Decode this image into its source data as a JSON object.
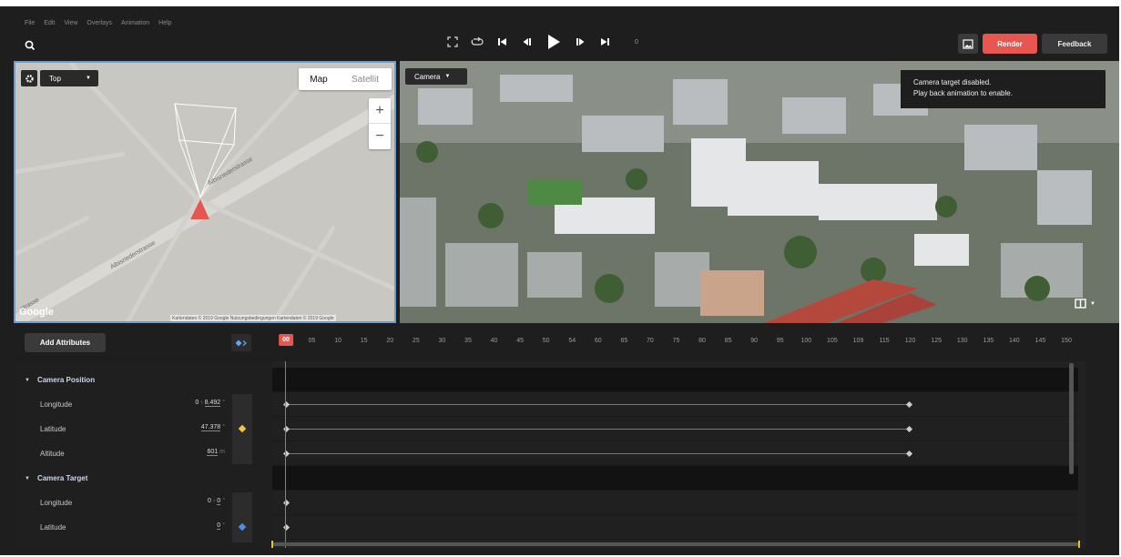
{
  "menu": [
    "File",
    "Edit",
    "View",
    "Overlays",
    "Animation",
    "Help"
  ],
  "icons": {
    "search": "search-icon",
    "fullscreen": "fullscreen-icon",
    "loop": "loop-icon",
    "skip_start": "skip-start-icon",
    "step_back": "step-back-icon",
    "play": "play-icon",
    "step_forward": "step-forward-icon",
    "skip_end": "skip-end-icon",
    "image": "image-icon",
    "settings": "gear-icon",
    "layout": "split-layout-icon"
  },
  "transport": {
    "frame": "0"
  },
  "toolbar": {
    "render_label": "Render",
    "feedback_label": "Feedback"
  },
  "map": {
    "view_label": "Top",
    "tab_map": "Map",
    "tab_satellite": "Satellit",
    "zoom_in": "+",
    "zoom_out": "−",
    "logo": "Google",
    "attribution": "Kartendaten © 2019 Google   Nutzungsbedingungen   Kartendaten © 2019 Google",
    "streets": [
      "Albisriederstrasse",
      "Albisriederstrasse",
      "strasse"
    ]
  },
  "camera_view": {
    "selector_label": "Camera",
    "notice_line1": "Camera target disabled.",
    "notice_line2": "Play back animation to enable."
  },
  "timeline": {
    "add_attributes_label": "Add Attributes",
    "ticks": [
      "00",
      "05",
      "10",
      "15",
      "20",
      "25",
      "30",
      "35",
      "40",
      "45",
      "50",
      "54",
      "60",
      "65",
      "70",
      "75",
      "80",
      "85",
      "90",
      "95",
      "100",
      "105",
      "109",
      "115",
      "120",
      "125",
      "130",
      "135",
      "140",
      "145",
      "150"
    ],
    "current_frame": "00",
    "groups": [
      {
        "name": "Camera Position",
        "rows": [
          {
            "name": "Longitude",
            "v1": "0",
            "v2": "8.492",
            "unit": "°"
          },
          {
            "name": "Latitude",
            "v1": "",
            "v2": "47.378",
            "unit": "°"
          },
          {
            "name": "Altitude",
            "v1": "",
            "v2": "601",
            "unit": "m"
          }
        ]
      },
      {
        "name": "Camera Target",
        "rows": [
          {
            "name": "Longitude",
            "v1": "0",
            "v2": "0",
            "unit": "°"
          },
          {
            "name": "Latitude",
            "v1": "",
            "v2": "0",
            "unit": "°"
          }
        ]
      }
    ]
  },
  "colors": {
    "accent": "#e8574f",
    "keyframe_position": "#f5c542",
    "keyframe_target": "#4d8fe6",
    "map_border": "#6e9ccc"
  }
}
